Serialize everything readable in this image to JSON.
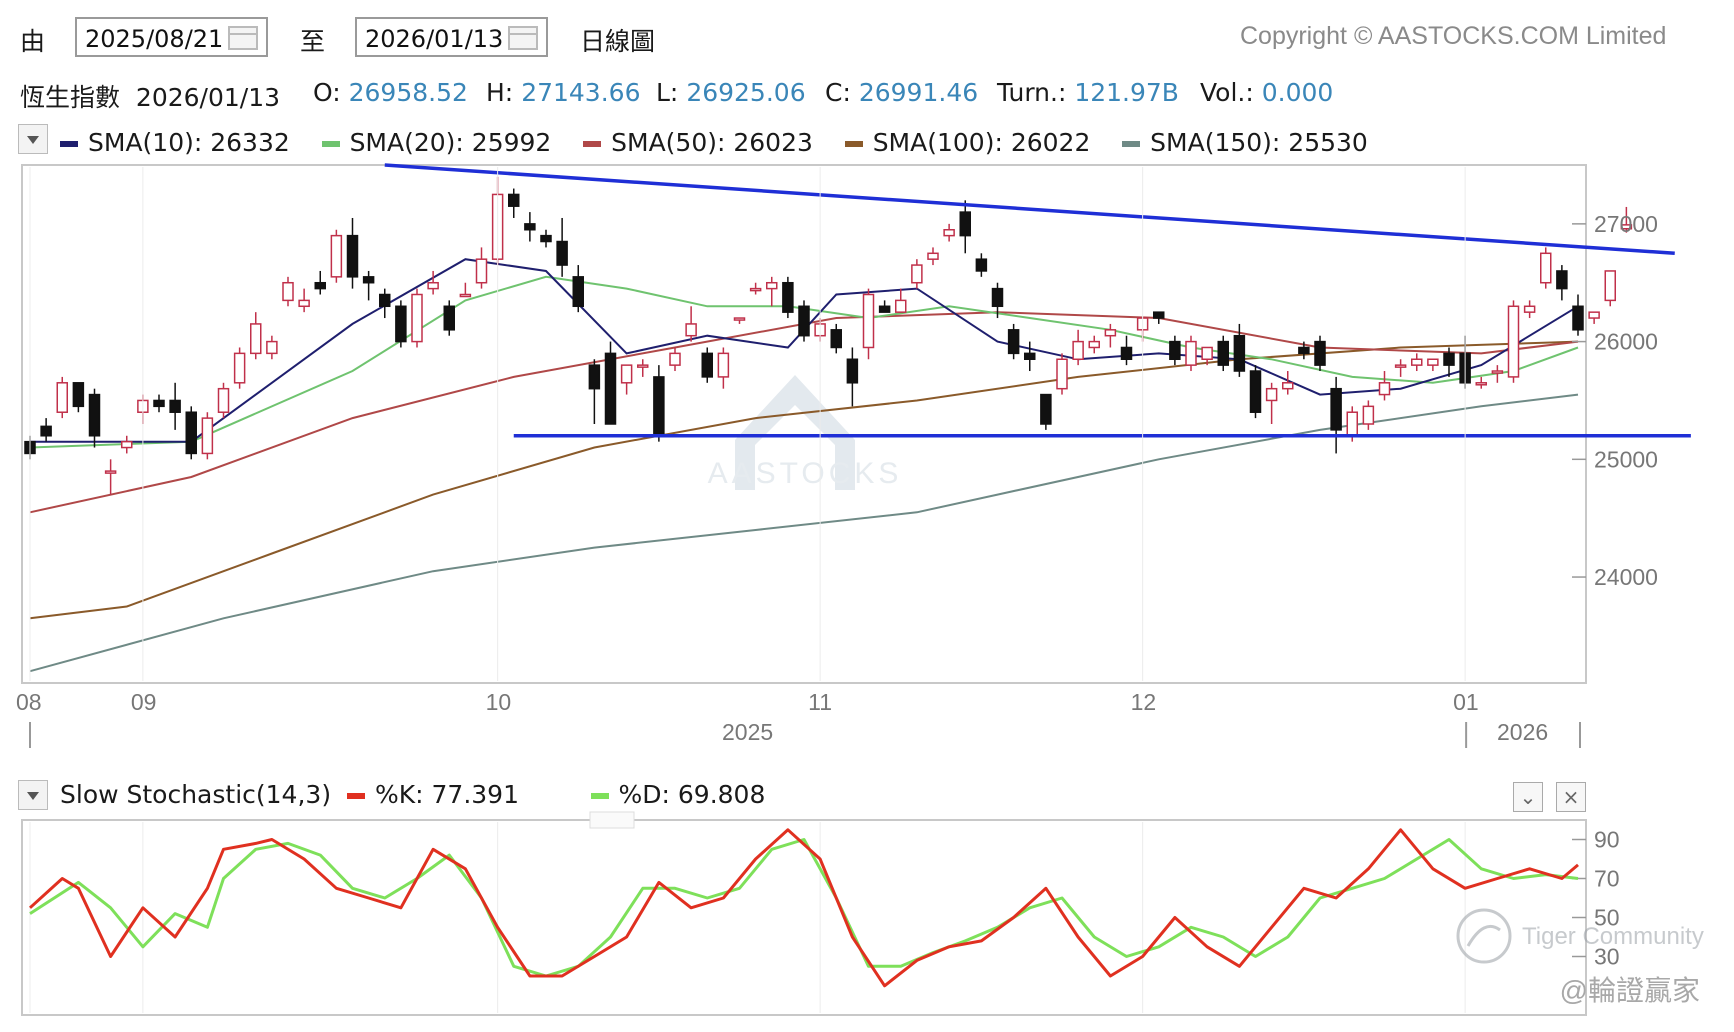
{
  "header": {
    "from_label": "由",
    "from_date": "2025/08/21",
    "to_label": "至",
    "to_date": "2026/01/13",
    "chart_kind": "日線圖",
    "copyright": "Copyright © AASTOCKS.COM Limited"
  },
  "quote": {
    "name": "恆生指數",
    "date": "2026/01/13",
    "open_label": "O:",
    "open": "26958.52",
    "high_label": "H:",
    "high": "27143.66",
    "low_label": "L:",
    "low": "26925.06",
    "close_label": "C:",
    "close": "26991.46",
    "turn_label": "Turn.:",
    "turn": "121.97B",
    "vol_label": "Vol.:",
    "vol": "0.000"
  },
  "sma_legend": [
    {
      "label": "SMA(10): 26332",
      "color": "#1f1f6e"
    },
    {
      "label": "SMA(20): 25992",
      "color": "#6fc36f"
    },
    {
      "label": "SMA(50): 26023",
      "color": "#b04848"
    },
    {
      "label": "SMA(100): 26022",
      "color": "#8a5a2a"
    },
    {
      "label": "SMA(150): 25530",
      "color": "#6f8a86"
    }
  ],
  "stochastic": {
    "title": "Slow Stochastic(14,3)",
    "k_label": "%K: 77.391",
    "d_label": "%D: 69.808",
    "k_color": "#e03020",
    "d_color": "#7ee05a"
  },
  "watermarks": {
    "center": "AASTOCKS",
    "community": "Tiger Community",
    "user": "@輪證贏家"
  },
  "chart_data": [
    {
      "type": "candlestick",
      "x_axis": {
        "month_ticks": [
          "08",
          "09",
          "10",
          "11",
          "12",
          "01"
        ],
        "month_tick_days": [
          0,
          7,
          29,
          49,
          69,
          89
        ],
        "year_labels": [
          "2025",
          "2026"
        ],
        "days_total": 96
      },
      "y_axis": {
        "ticks": [
          24000,
          25000,
          26000,
          27000
        ],
        "range": [
          23100,
          27500
        ],
        "side": "right"
      },
      "grid": false,
      "candles": [
        [
          25150,
          25200,
          25050,
          25000
        ],
        [
          25280,
          25350,
          25200,
          25150
        ],
        [
          25400,
          25700,
          25650,
          25350
        ],
        [
          25650,
          25650,
          25450,
          25400
        ],
        [
          25550,
          25600,
          25200,
          25100
        ],
        [
          24900,
          25000,
          24900,
          24700
        ],
        [
          25100,
          25200,
          25150,
          25050
        ],
        [
          25400,
          25550,
          25500,
          25300
        ],
        [
          25500,
          25550,
          25450,
          25400
        ],
        [
          25500,
          25650,
          25400,
          25250
        ],
        [
          25400,
          25450,
          25050,
          25000
        ],
        [
          25050,
          25400,
          25350,
          25000
        ],
        [
          25400,
          25650,
          25600,
          25350
        ],
        [
          25650,
          25950,
          25900,
          25600
        ],
        [
          25900,
          26250,
          26150,
          25850
        ],
        [
          25900,
          26050,
          26000,
          25850
        ],
        [
          26350,
          26550,
          26500,
          26300
        ],
        [
          26300,
          26450,
          26350,
          26250
        ],
        [
          26500,
          26600,
          26450,
          26400
        ],
        [
          26550,
          26950,
          26900,
          26500
        ],
        [
          26900,
          27050,
          26550,
          26450
        ],
        [
          26550,
          26600,
          26500,
          26350
        ],
        [
          26400,
          26450,
          26300,
          26200
        ],
        [
          26300,
          26350,
          26000,
          25950
        ],
        [
          26000,
          26450,
          26400,
          25950
        ],
        [
          26450,
          26600,
          26500,
          26400
        ],
        [
          26300,
          26350,
          26100,
          26050
        ],
        [
          26400,
          26500,
          26400,
          26400
        ],
        [
          26500,
          26800,
          26700,
          26450
        ],
        [
          26700,
          27400,
          27250,
          26650
        ],
        [
          27250,
          27300,
          27150,
          27050
        ],
        [
          27000,
          27100,
          26950,
          26850
        ],
        [
          26900,
          26950,
          26850,
          26800
        ],
        [
          26850,
          27050,
          26650,
          26550
        ],
        [
          26550,
          26650,
          26300,
          26250
        ],
        [
          25800,
          25850,
          25600,
          25300
        ],
        [
          25900,
          26000,
          25300,
          25300
        ],
        [
          25650,
          25800,
          25800,
          25550
        ],
        [
          25800,
          25850,
          25800,
          25700
        ],
        [
          25700,
          25800,
          25200,
          25150
        ],
        [
          25800,
          25950,
          25900,
          25750
        ],
        [
          26050,
          26300,
          26150,
          26000
        ],
        [
          25900,
          25950,
          25700,
          25650
        ],
        [
          25700,
          25950,
          25900,
          25600
        ],
        [
          26200,
          26200,
          26200,
          26150
        ],
        [
          26450,
          26500,
          26450,
          26400
        ],
        [
          26450,
          26550,
          26500,
          26300
        ],
        [
          26500,
          26550,
          26250,
          26200
        ],
        [
          26300,
          26350,
          26050,
          26000
        ],
        [
          26050,
          26200,
          26150,
          26000
        ],
        [
          26100,
          26150,
          25950,
          25900
        ],
        [
          25850,
          25950,
          25650,
          25450
        ],
        [
          25950,
          26450,
          26400,
          25850
        ],
        [
          26300,
          26350,
          26250,
          26250
        ],
        [
          26250,
          26450,
          26350,
          26250
        ],
        [
          26500,
          26700,
          26650,
          26450
        ],
        [
          26700,
          26800,
          26750,
          26650
        ],
        [
          26900,
          27000,
          26950,
          26850
        ],
        [
          27100,
          27200,
          26900,
          26750
        ],
        [
          26700,
          26750,
          26600,
          26550
        ],
        [
          26450,
          26500,
          26300,
          26200
        ],
        [
          26100,
          26150,
          25900,
          25850
        ],
        [
          25900,
          26000,
          25850,
          25750
        ],
        [
          25550,
          25550,
          25300,
          25250
        ],
        [
          25600,
          25900,
          25850,
          25550
        ],
        [
          25850,
          26100,
          26000,
          25800
        ],
        [
          25950,
          26050,
          26000,
          25900
        ],
        [
          26050,
          26150,
          26100,
          25950
        ],
        [
          25950,
          26050,
          25850,
          25800
        ],
        [
          26100,
          26200,
          26200,
          26000
        ],
        [
          26250,
          26250,
          26200,
          26150
        ],
        [
          26000,
          26050,
          25850,
          25800
        ],
        [
          25800,
          26050,
          26000,
          25750
        ],
        [
          25850,
          25950,
          25950,
          25800
        ],
        [
          26000,
          26050,
          25800,
          25750
        ],
        [
          26050,
          26150,
          25750,
          25700
        ],
        [
          25750,
          25800,
          25400,
          25350
        ],
        [
          25500,
          25650,
          25600,
          25300
        ],
        [
          25600,
          25750,
          25650,
          25550
        ],
        [
          25950,
          26000,
          25900,
          25850
        ],
        [
          26000,
          26050,
          25800,
          25750
        ],
        [
          25600,
          25700,
          25250,
          25050
        ],
        [
          25200,
          25450,
          25400,
          25150
        ],
        [
          25300,
          25500,
          25450,
          25250
        ],
        [
          25550,
          25750,
          25650,
          25500
        ],
        [
          25800,
          25850,
          25800,
          25700
        ],
        [
          25800,
          25900,
          25850,
          25750
        ],
        [
          25800,
          25850,
          25850,
          25750
        ],
        [
          25900,
          25950,
          25800,
          25700
        ],
        [
          25900,
          26050,
          25650,
          25600
        ],
        [
          25650,
          25700,
          25650,
          25600
        ],
        [
          25750,
          25800,
          25750,
          25650
        ],
        [
          25700,
          26350,
          26300,
          25650
        ],
        [
          26250,
          26350,
          26300,
          26200
        ],
        [
          26500,
          26800,
          26750,
          26450
        ],
        [
          26600,
          26650,
          26450,
          26350
        ],
        [
          26300,
          26400,
          26100,
          26050
        ],
        [
          26200,
          26250,
          26250,
          26150
        ],
        [
          26350,
          26600,
          26600,
          26300
        ],
        [
          26958.52,
          27143.66,
          26991.46,
          26925.06
        ]
      ],
      "sma_series": [
        {
          "name": "SMA(10)",
          "color": "#1f1f6e",
          "days": [
            0,
            10,
            20,
            27,
            32,
            37,
            42,
            47,
            50,
            55,
            60,
            65,
            70,
            75,
            80,
            85,
            90,
            96
          ],
          "values": [
            25150,
            25150,
            26150,
            26700,
            26600,
            25900,
            26050,
            25950,
            26400,
            26450,
            26000,
            25850,
            25900,
            25850,
            25550,
            25600,
            25800,
            26300
          ]
        },
        {
          "name": "SMA(20)",
          "color": "#6fc36f",
          "days": [
            0,
            10,
            20,
            27,
            32,
            37,
            42,
            47,
            52,
            57,
            62,
            67,
            72,
            77,
            82,
            87,
            92,
            96
          ],
          "values": [
            25100,
            25150,
            25750,
            26350,
            26550,
            26450,
            26300,
            26300,
            26200,
            26300,
            26200,
            26100,
            25950,
            25850,
            25700,
            25650,
            25750,
            25950
          ]
        },
        {
          "name": "SMA(50)",
          "color": "#b04848",
          "days": [
            0,
            10,
            20,
            30,
            40,
            50,
            60,
            70,
            80,
            90,
            96
          ],
          "values": [
            24550,
            24850,
            25350,
            25700,
            25950,
            26200,
            26250,
            26200,
            25950,
            25900,
            26000
          ]
        },
        {
          "name": "SMA(100)",
          "color": "#8a5a2a",
          "days": [
            0,
            6,
            15,
            25,
            35,
            45,
            55,
            65,
            75,
            85,
            96
          ],
          "values": [
            23650,
            23750,
            24200,
            24700,
            25100,
            25350,
            25500,
            25700,
            25850,
            25950,
            26000
          ]
        },
        {
          "name": "SMA(150)",
          "color": "#6f8a86",
          "days": [
            0,
            12,
            25,
            35,
            45,
            55,
            60,
            70,
            80,
            90,
            96
          ],
          "values": [
            23200,
            23650,
            24050,
            24250,
            24400,
            24550,
            24700,
            25000,
            25250,
            25450,
            25550
          ]
        }
      ],
      "trendlines": [
        {
          "name": "descending resistance",
          "color": "#1f2fd6",
          "from": [
            22,
            27500
          ],
          "to": [
            102,
            26750
          ]
        },
        {
          "name": "horizontal support",
          "color": "#1f2fd6",
          "from": [
            30,
            25200
          ],
          "to": [
            103,
            25200
          ]
        }
      ]
    },
    {
      "type": "line",
      "title": "Slow Stochastic(14,3)",
      "y_axis": {
        "ticks": [
          30,
          50,
          70,
          90
        ],
        "range": [
          0,
          100
        ],
        "side": "right"
      },
      "grid": false,
      "series": [
        {
          "name": "%K",
          "color": "#e03020",
          "days": [
            0,
            2,
            3,
            5,
            7,
            9,
            11,
            12,
            14,
            15,
            17,
            19,
            21,
            23,
            25,
            27,
            29,
            31,
            33,
            35,
            37,
            39,
            41,
            43,
            45,
            47,
            49,
            51,
            53,
            55,
            57,
            59,
            61,
            63,
            65,
            67,
            69,
            71,
            73,
            75,
            77,
            79,
            81,
            83,
            85,
            87,
            89,
            91,
            93,
            95,
            96
          ],
          "values": [
            55,
            70,
            65,
            30,
            55,
            40,
            65,
            85,
            88,
            90,
            80,
            65,
            60,
            55,
            85,
            75,
            45,
            20,
            20,
            30,
            40,
            68,
            55,
            60,
            80,
            95,
            80,
            40,
            15,
            28,
            35,
            38,
            50,
            65,
            40,
            20,
            30,
            50,
            35,
            25,
            45,
            65,
            60,
            75,
            95,
            75,
            65,
            70,
            75,
            70,
            77
          ]
        },
        {
          "name": "%D",
          "color": "#7ee05a",
          "days": [
            0,
            3,
            5,
            7,
            9,
            11,
            12,
            14,
            16,
            18,
            20,
            22,
            24,
            26,
            28,
            30,
            32,
            34,
            36,
            38,
            40,
            42,
            44,
            46,
            48,
            50,
            52,
            54,
            56,
            58,
            60,
            62,
            64,
            66,
            68,
            70,
            72,
            74,
            76,
            78,
            80,
            82,
            84,
            86,
            88,
            90,
            92,
            94,
            96
          ],
          "values": [
            52,
            68,
            55,
            35,
            52,
            45,
            70,
            85,
            88,
            82,
            65,
            60,
            70,
            82,
            60,
            25,
            20,
            25,
            40,
            65,
            65,
            60,
            65,
            85,
            90,
            60,
            25,
            25,
            32,
            38,
            45,
            55,
            60,
            40,
            30,
            35,
            45,
            40,
            30,
            40,
            60,
            65,
            70,
            80,
            90,
            75,
            70,
            72,
            70
          ]
        }
      ]
    }
  ]
}
